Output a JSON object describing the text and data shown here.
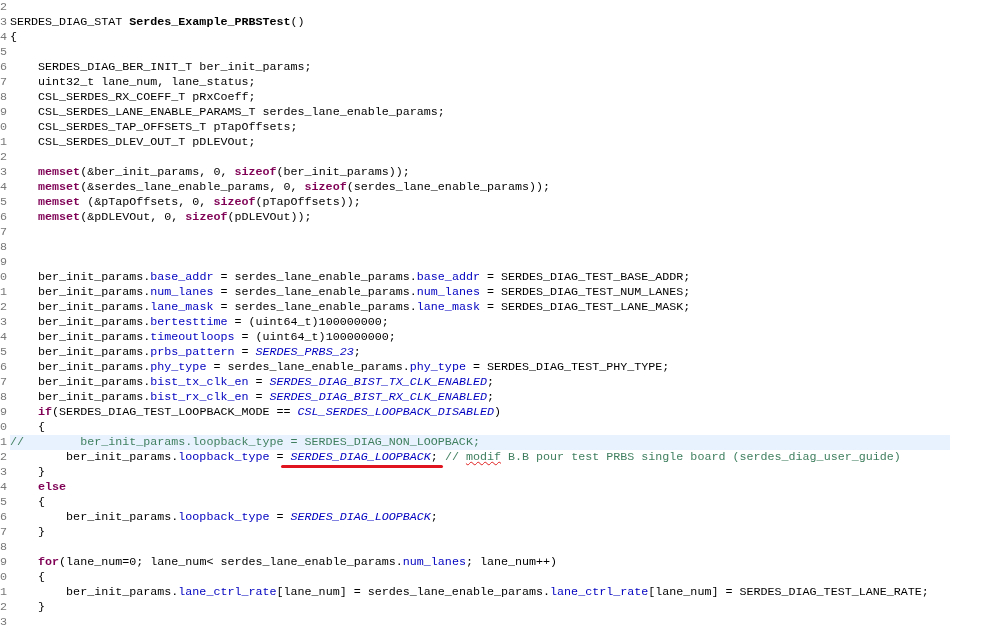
{
  "editor": {
    "lines": [
      {
        "number": "2",
        "current": false
      },
      {
        "number": "3",
        "current": false,
        "tokens": [
          {
            "kind": "plain",
            "text": "SERDES_DIAG_STAT "
          },
          {
            "kind": "function",
            "text": "Serdes_Example_PRBSTest"
          },
          {
            "kind": "plain",
            "text": "()"
          }
        ]
      },
      {
        "number": "4",
        "current": false,
        "tokens": [
          {
            "kind": "plain",
            "text": "{"
          }
        ]
      },
      {
        "number": "5",
        "current": false
      },
      {
        "number": "6",
        "current": false,
        "tokens": [
          {
            "kind": "plain",
            "text": "    SERDES_DIAG_BER_INIT_T ber_init_params;"
          }
        ]
      },
      {
        "number": "7",
        "current": false,
        "tokens": [
          {
            "kind": "plain",
            "text": "    uint32_t lane_num, lane_status;"
          }
        ]
      },
      {
        "number": "8",
        "current": false,
        "tokens": [
          {
            "kind": "plain",
            "text": "    CSL_SERDES_RX_COEFF_T pRxCoeff;"
          }
        ]
      },
      {
        "number": "9",
        "current": false,
        "tokens": [
          {
            "kind": "plain",
            "text": "    CSL_SERDES_LANE_ENABLE_PARAMS_T serdes_lane_enable_params;"
          }
        ]
      },
      {
        "number": "0",
        "current": false,
        "tokens": [
          {
            "kind": "plain",
            "text": "    CSL_SERDES_TAP_OFFSETS_T pTapOffsets;"
          }
        ]
      },
      {
        "number": "1",
        "current": false,
        "tokens": [
          {
            "kind": "plain",
            "text": "    CSL_SERDES_DLEV_OUT_T pDLEVOut;"
          }
        ]
      },
      {
        "number": "2",
        "current": false
      },
      {
        "number": "3",
        "current": false,
        "tokens": [
          {
            "kind": "keyword",
            "text": "    memset"
          },
          {
            "kind": "plain",
            "text": "(&ber_init_params, 0, "
          },
          {
            "kind": "keyword",
            "text": "sizeof"
          },
          {
            "kind": "plain",
            "text": "(ber_init_params));"
          }
        ]
      },
      {
        "number": "4",
        "current": false,
        "tokens": [
          {
            "kind": "keyword",
            "text": "    memset"
          },
          {
            "kind": "plain",
            "text": "(&serdes_lane_enable_params, 0, "
          },
          {
            "kind": "keyword",
            "text": "sizeof"
          },
          {
            "kind": "plain",
            "text": "(serdes_lane_enable_params));"
          }
        ]
      },
      {
        "number": "5",
        "current": false,
        "tokens": [
          {
            "kind": "keyword",
            "text": "    memset"
          },
          {
            "kind": "plain",
            "text": " (&pTapOffsets, 0, "
          },
          {
            "kind": "keyword",
            "text": "sizeof"
          },
          {
            "kind": "plain",
            "text": "(pTapOffsets));"
          }
        ]
      },
      {
        "number": "6",
        "current": false,
        "tokens": [
          {
            "kind": "keyword",
            "text": "    memset"
          },
          {
            "kind": "plain",
            "text": "(&pDLEVOut, 0, "
          },
          {
            "kind": "keyword",
            "text": "sizeof"
          },
          {
            "kind": "plain",
            "text": "(pDLEVOut));"
          }
        ]
      },
      {
        "number": "7",
        "current": false
      },
      {
        "number": "8",
        "current": false
      },
      {
        "number": "9",
        "current": false
      },
      {
        "number": "0",
        "current": false,
        "tokens": [
          {
            "kind": "plain",
            "text": "    ber_init_params."
          },
          {
            "kind": "field",
            "text": "base_addr"
          },
          {
            "kind": "plain",
            "text": " = serdes_lane_enable_params."
          },
          {
            "kind": "field",
            "text": "base_addr"
          },
          {
            "kind": "plain",
            "text": " = SERDES_DIAG_TEST_BASE_ADDR;"
          }
        ]
      },
      {
        "number": "1",
        "current": false,
        "tokens": [
          {
            "kind": "plain",
            "text": "    ber_init_params."
          },
          {
            "kind": "field",
            "text": "num_lanes"
          },
          {
            "kind": "plain",
            "text": " = serdes_lane_enable_params."
          },
          {
            "kind": "field",
            "text": "num_lanes"
          },
          {
            "kind": "plain",
            "text": " = SERDES_DIAG_TEST_NUM_LANES;"
          }
        ]
      },
      {
        "number": "2",
        "current": false,
        "tokens": [
          {
            "kind": "plain",
            "text": "    ber_init_params."
          },
          {
            "kind": "field",
            "text": "lane_mask"
          },
          {
            "kind": "plain",
            "text": " = serdes_lane_enable_params."
          },
          {
            "kind": "field",
            "text": "lane_mask"
          },
          {
            "kind": "plain",
            "text": " = SERDES_DIAG_TEST_LANE_MASK;"
          }
        ]
      },
      {
        "number": "3",
        "current": false,
        "tokens": [
          {
            "kind": "plain",
            "text": "    ber_init_params."
          },
          {
            "kind": "field",
            "text": "bertesttime"
          },
          {
            "kind": "plain",
            "text": " = (uint64_t)100000000;"
          }
        ]
      },
      {
        "number": "4",
        "current": false,
        "tokens": [
          {
            "kind": "plain",
            "text": "    ber_init_params."
          },
          {
            "kind": "field",
            "text": "timeoutloops"
          },
          {
            "kind": "plain",
            "text": " = (uint64_t)100000000;"
          }
        ]
      },
      {
        "number": "5",
        "current": false,
        "tokens": [
          {
            "kind": "plain",
            "text": "    ber_init_params."
          },
          {
            "kind": "field",
            "text": "prbs_pattern"
          },
          {
            "kind": "plain",
            "text": " = "
          },
          {
            "kind": "enum",
            "text": "SERDES_PRBS_23"
          },
          {
            "kind": "plain",
            "text": ";"
          }
        ]
      },
      {
        "number": "6",
        "current": false,
        "tokens": [
          {
            "kind": "plain",
            "text": "    ber_init_params."
          },
          {
            "kind": "field",
            "text": "phy_type"
          },
          {
            "kind": "plain",
            "text": " = serdes_lane_enable_params."
          },
          {
            "kind": "field",
            "text": "phy_type"
          },
          {
            "kind": "plain",
            "text": " = SERDES_DIAG_TEST_PHY_TYPE;"
          }
        ]
      },
      {
        "number": "7",
        "current": false,
        "tokens": [
          {
            "kind": "plain",
            "text": "    ber_init_params."
          },
          {
            "kind": "field",
            "text": "bist_tx_clk_en"
          },
          {
            "kind": "plain",
            "text": " = "
          },
          {
            "kind": "enum",
            "text": "SERDES_DIAG_BIST_TX_CLK_ENABLED"
          },
          {
            "kind": "plain",
            "text": ";"
          }
        ]
      },
      {
        "number": "8",
        "current": false,
        "tokens": [
          {
            "kind": "plain",
            "text": "    ber_init_params."
          },
          {
            "kind": "field",
            "text": "bist_rx_clk_en"
          },
          {
            "kind": "plain",
            "text": " = "
          },
          {
            "kind": "enum",
            "text": "SERDES_DIAG_BIST_RX_CLK_ENABLED"
          },
          {
            "kind": "plain",
            "text": ";"
          }
        ]
      },
      {
        "number": "9",
        "current": false,
        "tokens": [
          {
            "kind": "keyword",
            "text": "    if"
          },
          {
            "kind": "plain",
            "text": "(SERDES_DIAG_TEST_LOOPBACK_MODE == "
          },
          {
            "kind": "enum",
            "text": "CSL_SERDES_LOOPBACK_DISABLED"
          },
          {
            "kind": "plain",
            "text": ")"
          }
        ]
      },
      {
        "number": "0",
        "current": false,
        "tokens": [
          {
            "kind": "plain",
            "text": "    {"
          }
        ]
      },
      {
        "number": "1",
        "current": true,
        "tokens": [
          {
            "kind": "comment",
            "text": "//        ber_init_params.loopback_type = SERDES_DIAG_NON_LOOPBACK;"
          }
        ]
      },
      {
        "number": "2",
        "current": false,
        "tokens": [
          {
            "kind": "plain",
            "text": "        ber_init_params."
          },
          {
            "kind": "field",
            "text": "loopback_type"
          },
          {
            "kind": "plain",
            "text": " = "
          },
          {
            "kind": "enum_underlined",
            "text": "SERDES_DIAG_LOOPBACK"
          },
          {
            "kind": "plain",
            "text": "; "
          },
          {
            "kind": "comment",
            "text": "// "
          },
          {
            "kind": "comment_misspelled",
            "text": "modif"
          },
          {
            "kind": "comment",
            "text": " B.B pour test PRBS single board (serdes_diag_user_guide)"
          }
        ]
      },
      {
        "number": "3",
        "current": false,
        "tokens": [
          {
            "kind": "plain",
            "text": "    }"
          }
        ]
      },
      {
        "number": "4",
        "current": false,
        "tokens": [
          {
            "kind": "keyword",
            "text": "    else"
          }
        ]
      },
      {
        "number": "5",
        "current": false,
        "tokens": [
          {
            "kind": "plain",
            "text": "    {"
          }
        ]
      },
      {
        "number": "6",
        "current": false,
        "tokens": [
          {
            "kind": "plain",
            "text": "        ber_init_params."
          },
          {
            "kind": "field",
            "text": "loopback_type"
          },
          {
            "kind": "plain",
            "text": " = "
          },
          {
            "kind": "enum",
            "text": "SERDES_DIAG_LOOPBACK"
          },
          {
            "kind": "plain",
            "text": ";"
          }
        ]
      },
      {
        "number": "7",
        "current": false,
        "tokens": [
          {
            "kind": "plain",
            "text": "    }"
          }
        ]
      },
      {
        "number": "8",
        "current": false
      },
      {
        "number": "9",
        "current": false,
        "tokens": [
          {
            "kind": "keyword",
            "text": "    for"
          },
          {
            "kind": "plain",
            "text": "(lane_num=0; lane_num< serdes_lane_enable_params."
          },
          {
            "kind": "field",
            "text": "num_lanes"
          },
          {
            "kind": "plain",
            "text": "; lane_num++)"
          }
        ]
      },
      {
        "number": "0",
        "current": false,
        "tokens": [
          {
            "kind": "plain",
            "text": "    {"
          }
        ]
      },
      {
        "number": "1",
        "current": false,
        "tokens": [
          {
            "kind": "plain",
            "text": "        ber_init_params."
          },
          {
            "kind": "field",
            "text": "lane_ctrl_rate"
          },
          {
            "kind": "plain",
            "text": "[lane_num] = serdes_lane_enable_params."
          },
          {
            "kind": "field",
            "text": "lane_ctrl_rate"
          },
          {
            "kind": "plain",
            "text": "[lane_num] = SERDES_DIAG_TEST_LANE_RATE;"
          }
        ]
      },
      {
        "number": "2",
        "current": false,
        "tokens": [
          {
            "kind": "plain",
            "text": "    }"
          }
        ]
      },
      {
        "number": "3",
        "current": false
      }
    ]
  }
}
